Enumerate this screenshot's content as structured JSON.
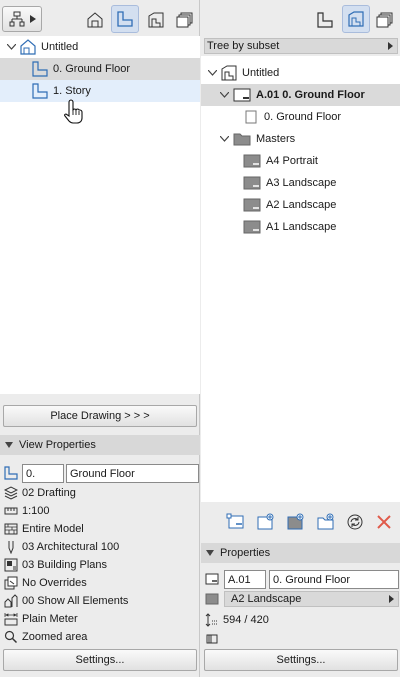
{
  "left": {
    "tree": {
      "root": "Untitled",
      "items": [
        "0. Ground Floor",
        "1. Story"
      ]
    },
    "place_button": "Place Drawing > > >",
    "view_properties": {
      "header": "View Properties",
      "id_value": "0.",
      "name_value": "Ground Floor",
      "rows": [
        "02 Drafting",
        "1:100",
        "Entire Model",
        "03 Architectural 100",
        "03 Building Plans",
        "No Overrides",
        "00 Show All Elements",
        "Plain Meter",
        "Zoomed area"
      ]
    },
    "settings_button": "Settings..."
  },
  "right": {
    "dropdown": "Tree by subset",
    "tree": {
      "root": "Untitled",
      "layout": "A.01 0. Ground Floor",
      "layout_child": "0. Ground Floor",
      "masters": "Masters",
      "master_items": [
        "A4 Portrait",
        "A3 Landscape",
        "A2 Landscape",
        "A1 Landscape"
      ]
    },
    "properties": {
      "header": "Properties",
      "id_value": "A.01",
      "name_value": "0. Ground Floor",
      "master": "A2 Landscape",
      "size": "594 / 420"
    },
    "settings_button": "Settings..."
  },
  "colors": {
    "accent": "#2f6db5",
    "selection_blue": "#e3eefb",
    "selection_grey": "#dadada",
    "delete_red": "#e05a4a"
  }
}
